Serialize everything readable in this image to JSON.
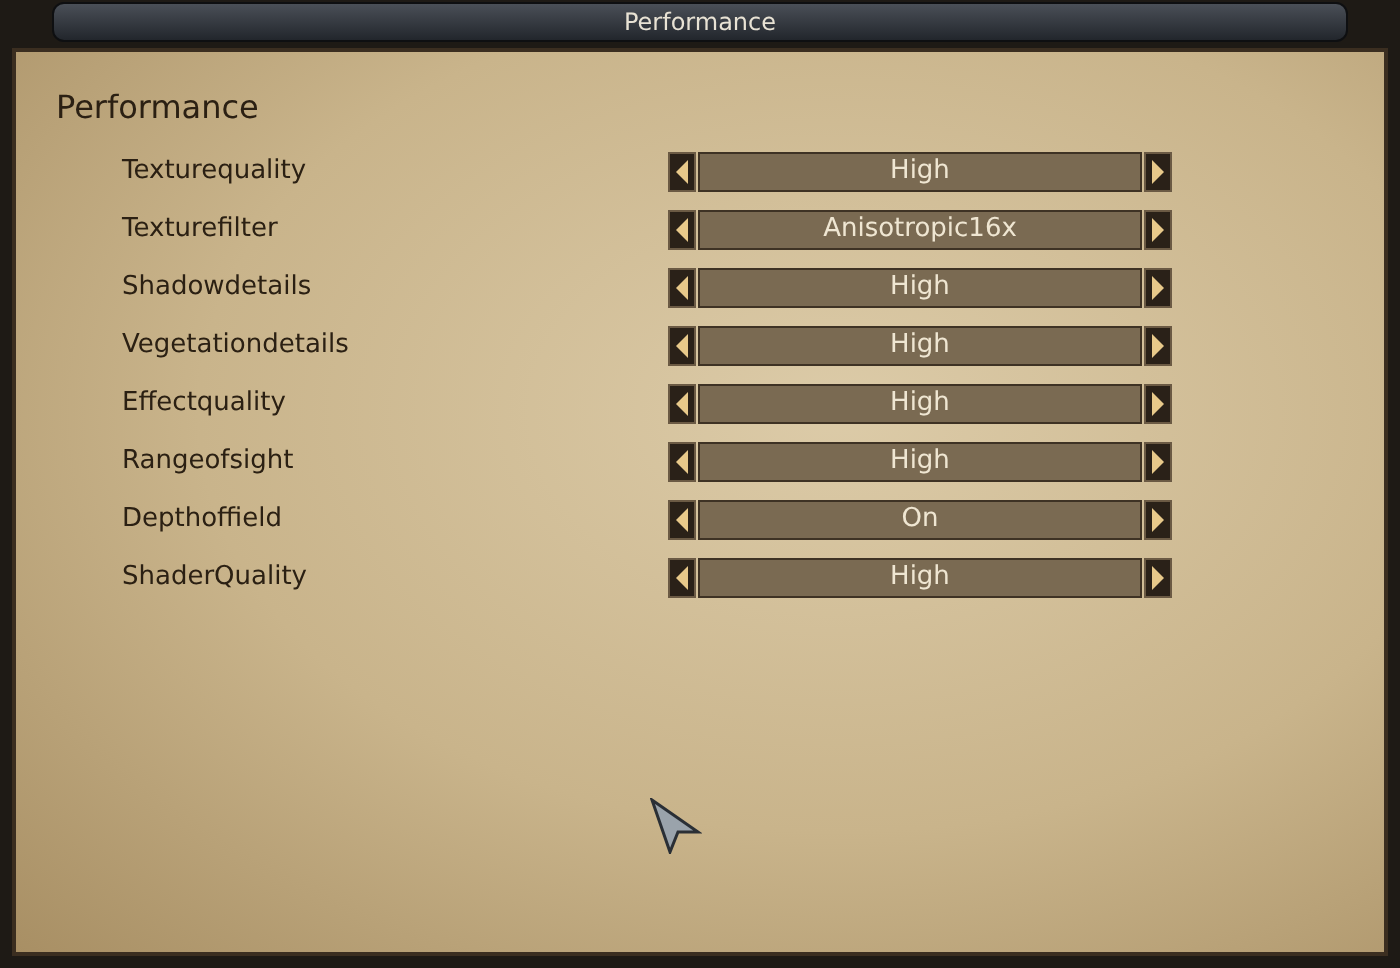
{
  "window": {
    "title": "Performance"
  },
  "heading": "Performance",
  "settings": [
    {
      "label": "Texturequality",
      "value": "High"
    },
    {
      "label": "Texturefilter",
      "value": "Anisotropic16x"
    },
    {
      "label": "Shadowdetails",
      "value": "High"
    },
    {
      "label": "Vegetationdetails",
      "value": "High"
    },
    {
      "label": "Effectquality",
      "value": "High"
    },
    {
      "label": "Rangeofsight",
      "value": "High"
    },
    {
      "label": "Depthoffield",
      "value": "On"
    },
    {
      "label": "ShaderQuality",
      "value": "High"
    }
  ]
}
